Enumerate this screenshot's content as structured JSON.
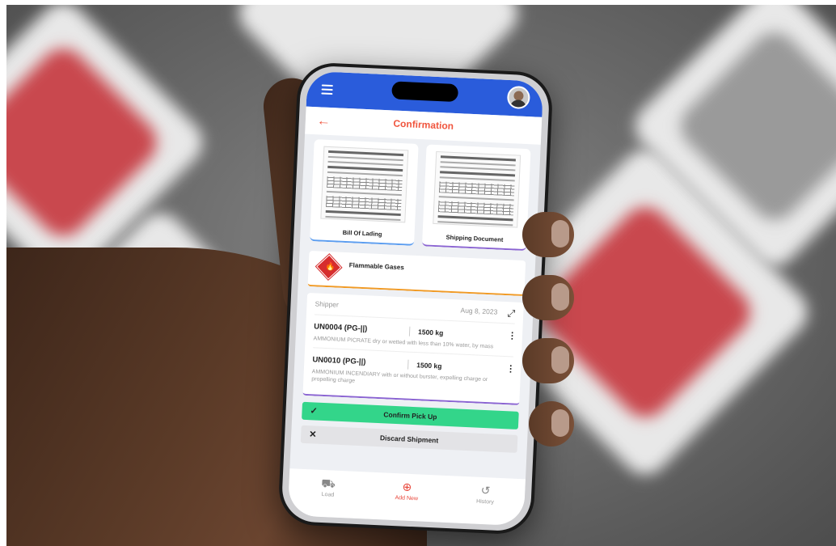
{
  "app": {
    "screen_title": "Confirmation"
  },
  "documents": [
    {
      "label": "Bill Of Lading"
    },
    {
      "label": "Shipping Document"
    }
  ],
  "hazard": {
    "label": "Flammable Gases",
    "icon": "flame-placard-icon",
    "color": "#d62d2d"
  },
  "shipment": {
    "shipper_label": "Shipper",
    "date": "Aug 8, 2023",
    "items": [
      {
        "code": "UN0004 (PG-||)",
        "weight": "1500 kg",
        "description": "AMMONIUM PICRATE dry or wetted with less than 10% water, by mass"
      },
      {
        "code": "UN0010 (PG-||)",
        "weight": "1500 kg",
        "description": "AMMONIUM INCENDIARY with or without burster, expelling charge or propelling charge"
      }
    ]
  },
  "actions": {
    "confirm_label": "Confirm Pick Up",
    "discard_label": "Discard Shipment"
  },
  "bottom_nav": [
    {
      "label": "Load",
      "icon": "truck-icon"
    },
    {
      "label": "Add New",
      "icon": "plus-circle-icon"
    },
    {
      "label": "History",
      "icon": "history-icon"
    }
  ],
  "colors": {
    "primary": "#2a5cdb",
    "accent": "#f0563f",
    "confirm": "#33d58a"
  }
}
